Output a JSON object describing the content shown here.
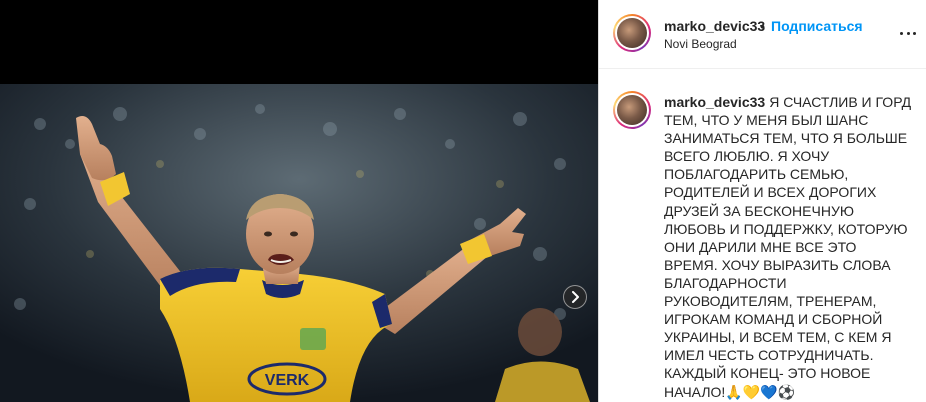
{
  "header": {
    "username": "marko_devic33",
    "separator": "•",
    "follow_label": "Подписаться",
    "location": "Novi Beograd"
  },
  "caption": {
    "username": "marko_devic33",
    "text": "Я СЧАСТЛИВ И ГОРД ТЕМ, ЧТО У МЕНЯ БЫЛ ШАНС ЗАНИМАТЬСЯ ТЕМ, ЧТО Я БОЛЬШЕ ВСЕГО ЛЮБЛЮ. Я ХОЧУ ПОБЛАГОДАРИТЬ СЕМЬЮ, РОДИТЕЛЕЙ И ВСЕХ ДОРОГИХ ДРУЗЕЙ ЗА БЕСКОНЕЧНУЮ ЛЮБОВЬ И ПОДДЕРЖКУ, КОТОРУЮ ОНИ ДАРИЛИ МНЕ ВСЕ ЭТО ВРЕМЯ. ХОЧУ ВЫРАЗИТЬ СЛОВА БЛАГОДАРНОСТИ РУКОВОДИТЕЛЯМ, ТРЕНЕРАМ, ИГРОКАМ КОМАНД И СБОРНОЙ УКРАИНЫ, И ВСЕМ ТЕМ, С КЕМ Я ИМЕЛ ЧЕСТЬ СОТРУДНИЧАТЬ. КАЖДЫЙ КОНЕЦ- ЭТО НОВОЕ НАЧАЛО!🙏💛💙⚽"
  },
  "media": {
    "jersey_text": "VERK",
    "next_icon": "chevron-right-icon"
  },
  "colors": {
    "follow": "#0095f6",
    "jersey": "#f4c52a",
    "jersey_trim": "#1c2a6b"
  }
}
